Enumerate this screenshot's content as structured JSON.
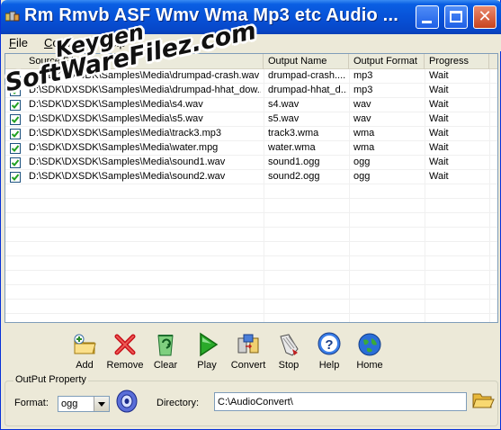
{
  "window": {
    "title": "Rm Rmvb ASF Wmv Wma Mp3 etc Audio ...",
    "minimize_icon": "minimize-icon",
    "maximize_icon": "maximize-icon",
    "close_glyph": "✕"
  },
  "menu": {
    "items": [
      {
        "label": "File"
      },
      {
        "label": "Convert"
      },
      {
        "label": "Help"
      }
    ]
  },
  "list": {
    "columns": [
      {
        "label": "Source File"
      },
      {
        "label": "Output Name"
      },
      {
        "label": "Output Format"
      },
      {
        "label": "Progress"
      }
    ],
    "rows": [
      {
        "checked": true,
        "source": "D:\\SDK\\DXSDK\\Samples\\Media\\drumpad-crash.wav",
        "name": "drumpad-crash....",
        "format": "mp3",
        "progress": "Wait"
      },
      {
        "checked": true,
        "source": "D:\\SDK\\DXSDK\\Samples\\Media\\drumpad-hhat_dow...",
        "name": "drumpad-hhat_d...",
        "format": "mp3",
        "progress": "Wait"
      },
      {
        "checked": true,
        "source": "D:\\SDK\\DXSDK\\Samples\\Media\\s4.wav",
        "name": "s4.wav",
        "format": "wav",
        "progress": "Wait"
      },
      {
        "checked": true,
        "source": "D:\\SDK\\DXSDK\\Samples\\Media\\s5.wav",
        "name": "s5.wav",
        "format": "wav",
        "progress": "Wait"
      },
      {
        "checked": true,
        "source": "D:\\SDK\\DXSDK\\Samples\\Media\\track3.mp3",
        "name": "track3.wma",
        "format": "wma",
        "progress": "Wait"
      },
      {
        "checked": true,
        "source": "D:\\SDK\\DXSDK\\Samples\\Media\\water.mpg",
        "name": "water.wma",
        "format": "wma",
        "progress": "Wait"
      },
      {
        "checked": true,
        "source": "D:\\SDK\\DXSDK\\Samples\\Media\\sound1.wav",
        "name": "sound1.ogg",
        "format": "ogg",
        "progress": "Wait"
      },
      {
        "checked": true,
        "source": "D:\\SDK\\DXSDK\\Samples\\Media\\sound2.wav",
        "name": "sound2.ogg",
        "format": "ogg",
        "progress": "Wait"
      }
    ]
  },
  "toolbar": {
    "add": {
      "label": "Add",
      "icon": "add-folder-icon"
    },
    "remove": {
      "label": "Remove",
      "icon": "remove-x-icon"
    },
    "clear": {
      "label": "Clear",
      "icon": "recycle-bin-icon"
    },
    "play": {
      "label": "Play",
      "icon": "play-arrow-icon"
    },
    "convert": {
      "label": "Convert",
      "icon": "convert-icon"
    },
    "stop": {
      "label": "Stop",
      "icon": "stop-hand-icon"
    },
    "help": {
      "label": "Help",
      "icon": "help-question-icon"
    },
    "home": {
      "label": "Home",
      "icon": "globe-home-icon"
    }
  },
  "output_property": {
    "title": "OutPut Property",
    "format_label": "Format:",
    "format_value": "ogg",
    "directory_label": "Directory:",
    "directory_value": "C:\\AudioConvert\\"
  },
  "watermark": {
    "line1": "Keygen",
    "line2": "SoftWareFilez.com"
  },
  "colors": {
    "titlebar": "#0752d8",
    "window_bg": "#ece9d8",
    "checkbox_check": "#21a121"
  }
}
